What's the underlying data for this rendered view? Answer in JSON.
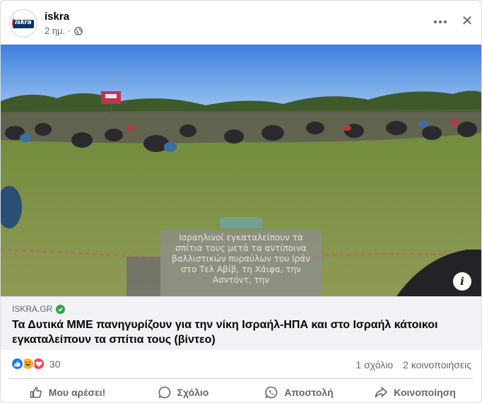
{
  "post": {
    "page_name": "iskra",
    "avatar_text": "iskra",
    "time": "2 ημ.",
    "separator": "·",
    "audience_icon": "globe-icon"
  },
  "media": {
    "overlay_text": "Ισραηλινοί εγκαταλείπουν τα σπίτια τους μετά τα αντίποινα βαλλιστικών πυραύλων του Ιράν στο Τελ Αβίβ, τη Χάιφα, την Ασντόντ, την",
    "info_label": "i"
  },
  "link": {
    "domain": "ISKRA.GR",
    "headline": "Τα Δυτικά ΜΜΕ πανηγυρίζουν για την νίκη Ισραήλ-ΗΠΑ και στο Ισραήλ κάτοικοι εγκαταλείπουν τα σπίτια τους (βίντεο)"
  },
  "stats": {
    "reaction_count": "30",
    "comments": "1 σχόλιο",
    "shares": "2 κοινοποιήσεις"
  },
  "actions": {
    "like": "Μου αρέσει!",
    "comment": "Σχόλιο",
    "send": "Αποστολή",
    "share": "Κοινοποίηση"
  },
  "colors": {
    "like_blue": "#1877f2",
    "haha_yellow": "#f7b125",
    "love_red": "#f33e58",
    "verified_green": "#31a24c",
    "secondary_text": "#65676b"
  }
}
